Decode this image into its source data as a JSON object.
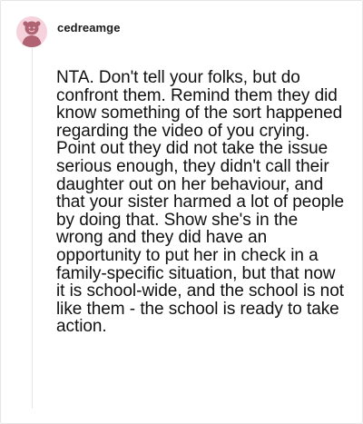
{
  "comment": {
    "username": "cedreamge",
    "avatar_icon": "smiling-figure-avatar",
    "avatar_bg": "#f6d3dc",
    "body": "NTA. Don't tell your folks, but do confront them. Remind them they did know something of the sort happened regarding the video of you crying. Point out they did not take the issue serious enough, they didn't call their daughter out on her behaviour, and that your sister harmed a lot of people by doing that. Show she's in the wrong and they did have an opportunity to put her in check in a family-specific situation, but that now it is school-wide, and the school is not like them - the school is ready to take action."
  }
}
